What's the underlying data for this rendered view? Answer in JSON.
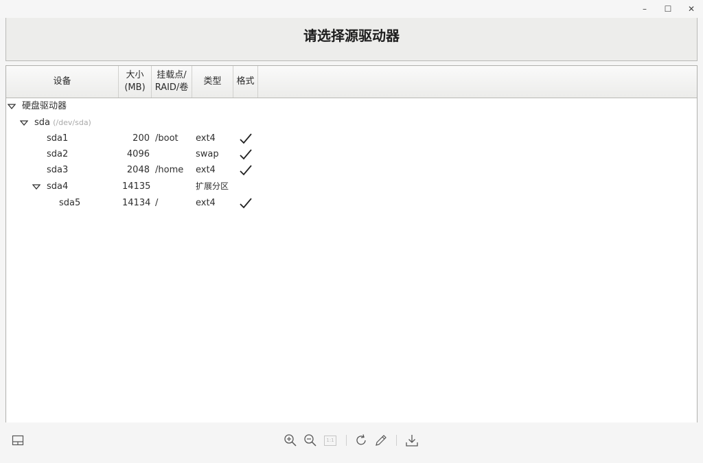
{
  "window": {
    "minimize_glyph": "–",
    "maximize_glyph": "☐",
    "close_glyph": "✕"
  },
  "header": {
    "title": "请选择源驱动器"
  },
  "table": {
    "columns": {
      "device": "设备",
      "size_line1": "大小",
      "size_line2": "(MB)",
      "mount_line1": "挂载点/",
      "mount_line2": "RAID/卷",
      "type": "类型",
      "format": "格式"
    },
    "group": {
      "label": "硬盘驱动器"
    },
    "disk": {
      "name": "sda",
      "path": "(/dev/sda)"
    },
    "rows": [
      {
        "device": "sda1",
        "size": "200",
        "mount": "/boot",
        "type": "ext4",
        "format": true
      },
      {
        "device": "sda2",
        "size": "4096",
        "mount": "",
        "type": "swap",
        "format": true
      },
      {
        "device": "sda3",
        "size": "2048",
        "mount": "/home",
        "type": "ext4",
        "format": true
      },
      {
        "device": "sda4",
        "size": "14135",
        "mount": "",
        "type": "扩展分区",
        "format": false
      },
      {
        "device": "sda5",
        "size": "14134",
        "mount": "/",
        "type": "ext4",
        "format": true
      }
    ]
  },
  "toolbar": {
    "fit_label": "1:1",
    "icons": [
      "sidebar-toggle-icon",
      "zoom-in-icon",
      "zoom-out-icon",
      "actual-size-icon",
      "rotate-icon",
      "edit-icon",
      "download-icon"
    ]
  }
}
